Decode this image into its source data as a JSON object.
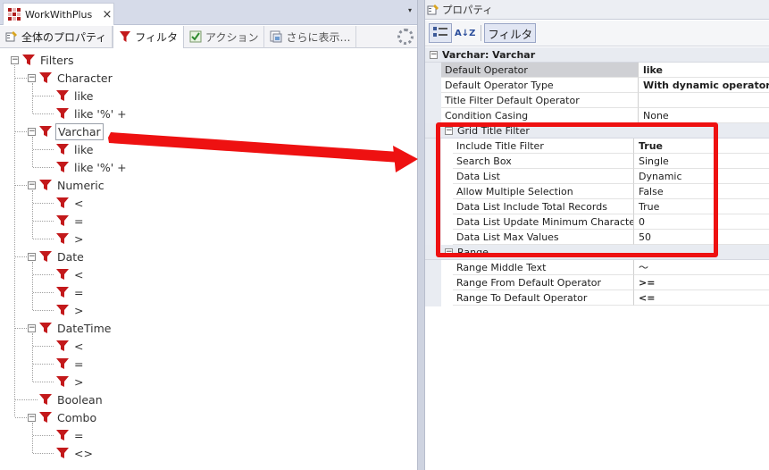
{
  "doc_tab": {
    "title": "WorkWithPlus",
    "close": "×"
  },
  "pane_menu": "▾",
  "subtabs": [
    {
      "label": "全体のプロパティ"
    },
    {
      "label": "フィルタ"
    },
    {
      "label": "アクション"
    },
    {
      "label": "さらに表示…"
    }
  ],
  "tree": {
    "root": "Filters",
    "nodes": [
      {
        "label": "Character"
      },
      {
        "label": "like"
      },
      {
        "label": "like '%' +"
      },
      {
        "label": "Varchar"
      },
      {
        "label": "like"
      },
      {
        "label": "like '%' +"
      },
      {
        "label": "Numeric"
      },
      {
        "label": "<"
      },
      {
        "label": "="
      },
      {
        "label": ">"
      },
      {
        "label": "Date"
      },
      {
        "label": "<"
      },
      {
        "label": "="
      },
      {
        "label": ">"
      },
      {
        "label": "DateTime"
      },
      {
        "label": "<"
      },
      {
        "label": "="
      },
      {
        "label": ">"
      },
      {
        "label": "Boolean"
      },
      {
        "label": "Combo"
      },
      {
        "label": "="
      },
      {
        "label": "<>"
      }
    ]
  },
  "properties": {
    "window_title": "プロパティ",
    "toolbar": {
      "sort_icon_text": "A↓Z",
      "filter_label": "フィルタ"
    },
    "header": "Varchar: Varchar",
    "rows": [
      {
        "name": "Default Operator",
        "value": "like"
      },
      {
        "name": "Default Operator Type",
        "value": "With dynamic operators"
      },
      {
        "name": "Title Filter Default Operator",
        "value": ""
      },
      {
        "name": "Condition Casing",
        "value": "None"
      }
    ],
    "category1": "Grid Title Filter",
    "rows1": [
      {
        "name": "Include Title Filter",
        "value": "True"
      },
      {
        "name": "Search Box",
        "value": "Single"
      },
      {
        "name": "Data List",
        "value": "Dynamic"
      },
      {
        "name": "Allow Multiple Selection",
        "value": "False"
      },
      {
        "name": "Data List Include Total Records",
        "value": "True"
      },
      {
        "name": "Data List Update Minimum Characters",
        "value": "0"
      },
      {
        "name": "Data List Max Values",
        "value": "50"
      }
    ],
    "category2": "Range",
    "rows2": [
      {
        "name": "Range Middle Text",
        "value": "～"
      },
      {
        "name": "Range From Default Operator",
        "value": ">="
      },
      {
        "name": "Range To Default Operator",
        "value": "<="
      }
    ]
  },
  "colors": {
    "accent_red": "#ee1111",
    "funnel_red": "#c3191b",
    "selected_row": "#cfd0d4"
  }
}
